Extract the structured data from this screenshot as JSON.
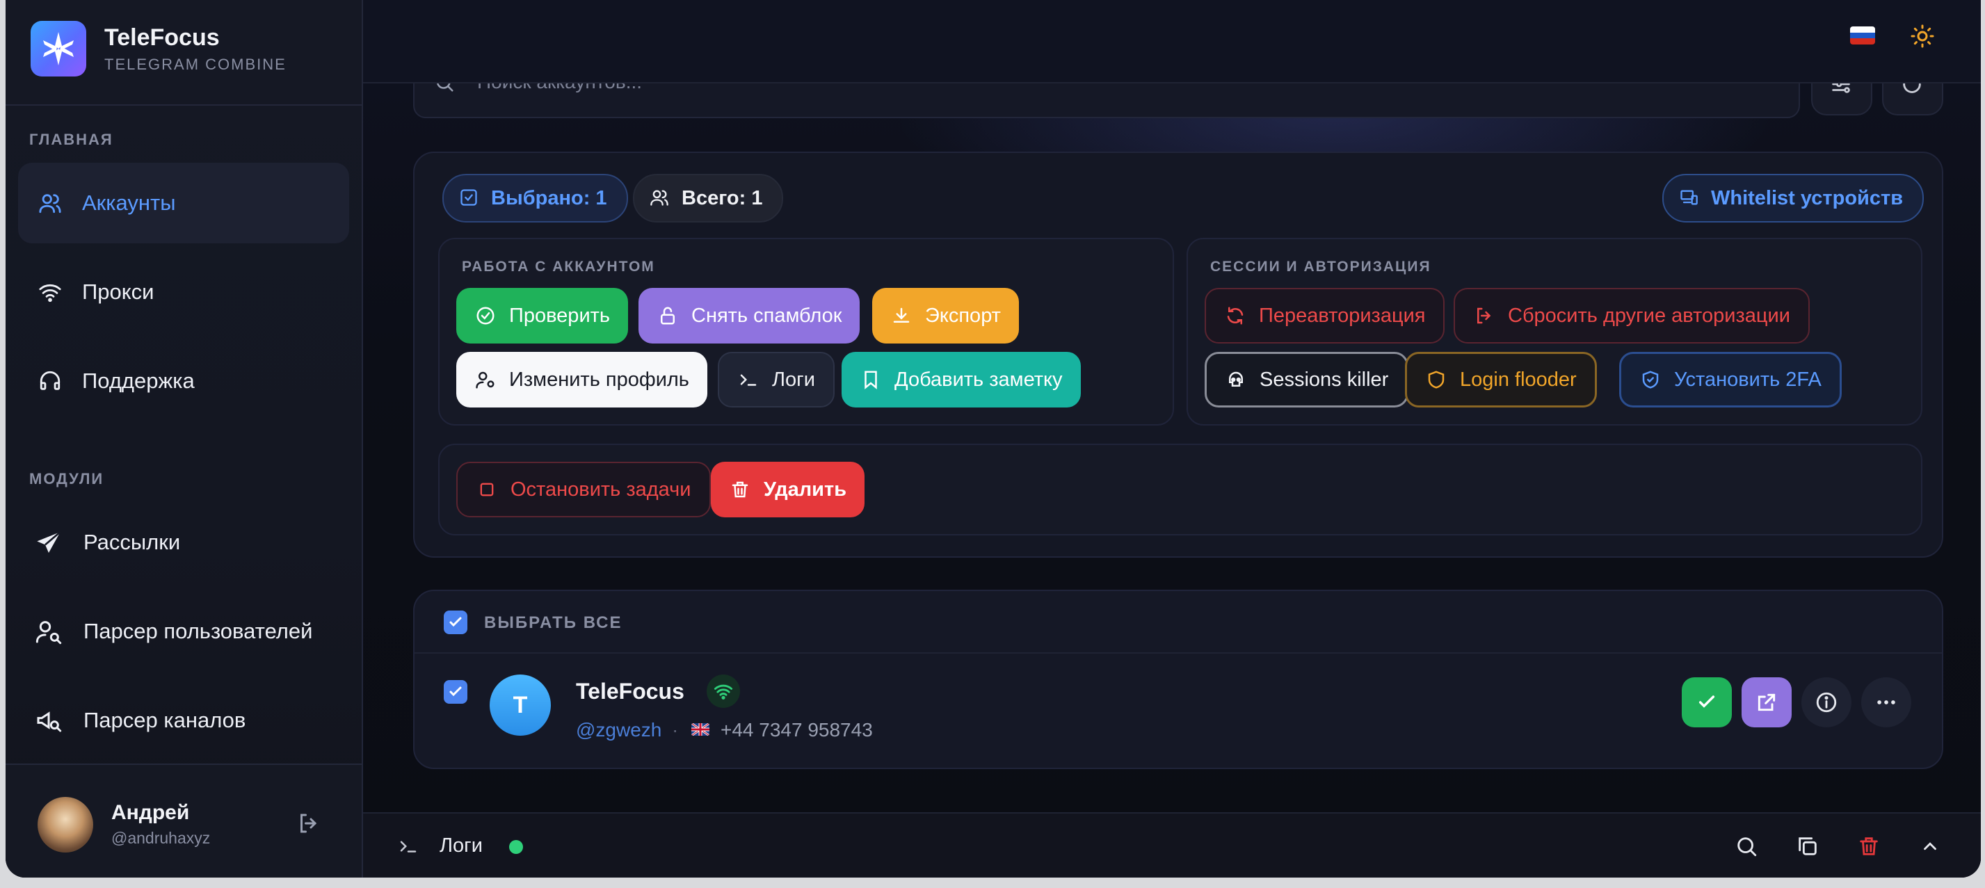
{
  "app": {
    "name": "TeleFocus",
    "subtitle": "TELEGRAM COMBINE"
  },
  "sidebar": {
    "section_main": "ГЛАВНАЯ",
    "section_modules": "МОДУЛИ",
    "main_items": [
      {
        "label": "Аккаунты",
        "icon": "users-icon",
        "active": true
      },
      {
        "label": "Прокси",
        "icon": "wifi-icon",
        "active": false
      },
      {
        "label": "Поддержка",
        "icon": "headset-icon",
        "active": false
      }
    ],
    "module_items": [
      {
        "label": "Рассылки",
        "icon": "send-icon"
      },
      {
        "label": "Парсер пользователей",
        "icon": "user-search-icon"
      },
      {
        "label": "Парсер каналов",
        "icon": "megaphone-search-icon"
      }
    ],
    "user": {
      "name": "Андрей",
      "handle": "@andruhaxyz"
    }
  },
  "topbar": {
    "language_flag": "ru",
    "theme_icon": "sun-icon"
  },
  "search": {
    "placeholder": "Поиск аккаунтов..."
  },
  "panel": {
    "selected_label": "Выбрано: 1",
    "total_label": "Всего: 1",
    "whitelist_label": "Whitelist устройств",
    "account_section": {
      "title": "РАБОТА С АККАУНТОМ",
      "buttons": {
        "check": "Проверить",
        "unspam": "Снять спамблок",
        "export": "Экспорт",
        "edit_profile": "Изменить профиль",
        "logs": "Логи",
        "add_note": "Добавить заметку"
      }
    },
    "sessions_section": {
      "title": "СЕССИИ И АВТОРИЗАЦИЯ",
      "buttons": {
        "reauth": "Переавторизация",
        "reset_auth": "Сбросить другие авторизации",
        "sessions_killer": "Sessions killer",
        "login_flooder": "Login flooder",
        "set_2fa": "Установить 2FA"
      }
    },
    "danger": {
      "stop_tasks": "Остановить задачи",
      "delete": "Удалить"
    }
  },
  "accounts": {
    "select_all_label": "ВЫБРАТЬ ВСЕ",
    "rows": [
      {
        "avatar_letter": "T",
        "name": "TeleFocus",
        "handle": "@zgwezh",
        "separator": "·",
        "phone": "+44 7347 958743",
        "checked": true
      }
    ]
  },
  "logbar": {
    "label": "Логи",
    "status_color": "#2fd07a"
  },
  "colors": {
    "accent": "#5b9bff",
    "green": "#1fb25a",
    "purple": "#8f73df",
    "orange": "#f2a62a",
    "teal": "#17b3a0",
    "red": "#e5383b"
  }
}
